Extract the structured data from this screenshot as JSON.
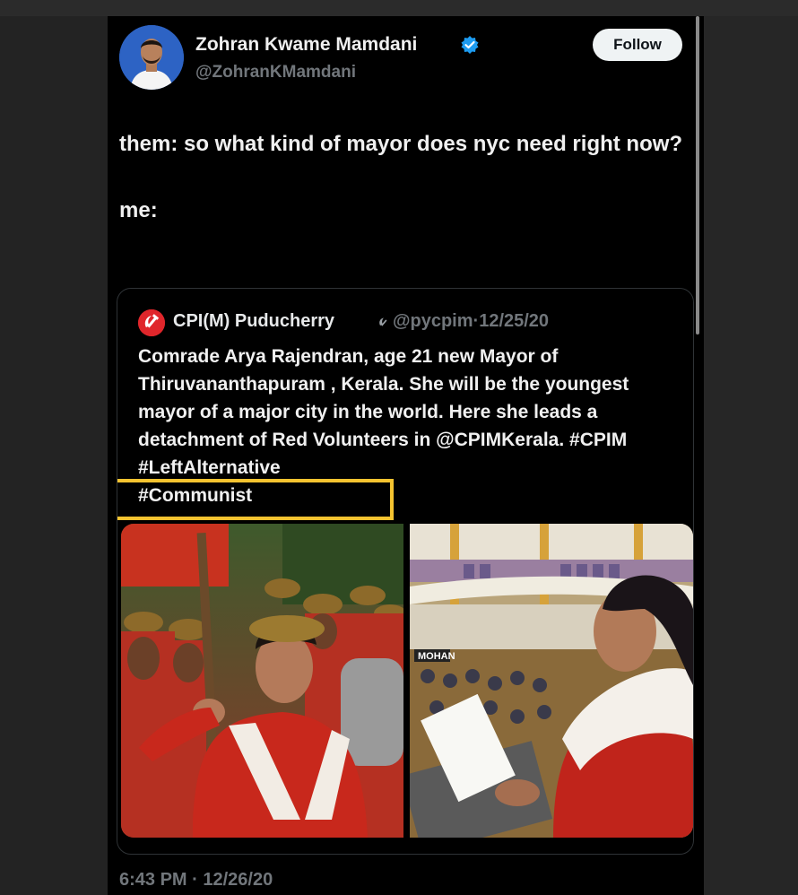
{
  "tweet": {
    "author_name": "Zohran Kwame Mamdani",
    "handle": "@ZohranKMamdani",
    "follow_label": "Follow",
    "text": "them: so what kind of mayor does nyc need right now?\n\nme:",
    "timestamp": "6:43 PM · 12/26/20"
  },
  "quoted_tweet": {
    "author_name": "CPI(M) Puducherry",
    "handle": "@pycpim",
    "date": "12/25/20",
    "text": "Comrade Arya Rajendran, age 21  new Mayor of Thiruvananthapuram , Kerala. She will be the youngest mayor of a major city in the world. Here she leads a detachment of Red Volunteers in @CPIMKerala. #CPIM  #LeftAlternative\n#Communist",
    "images": [
      {
        "description": "woman in beret saluting with a staff among red volunteers"
      },
      {
        "description": "woman reading an oath in a council chamber"
      }
    ],
    "highlight_color": "#f5c330"
  },
  "colors": {
    "background": "#000000",
    "text": "#e7e9ea",
    "muted": "#71767b",
    "verified": "#1d9bf0",
    "follow_bg": "#eff3f4",
    "party_red": "#e0262b"
  },
  "chart_data": null
}
